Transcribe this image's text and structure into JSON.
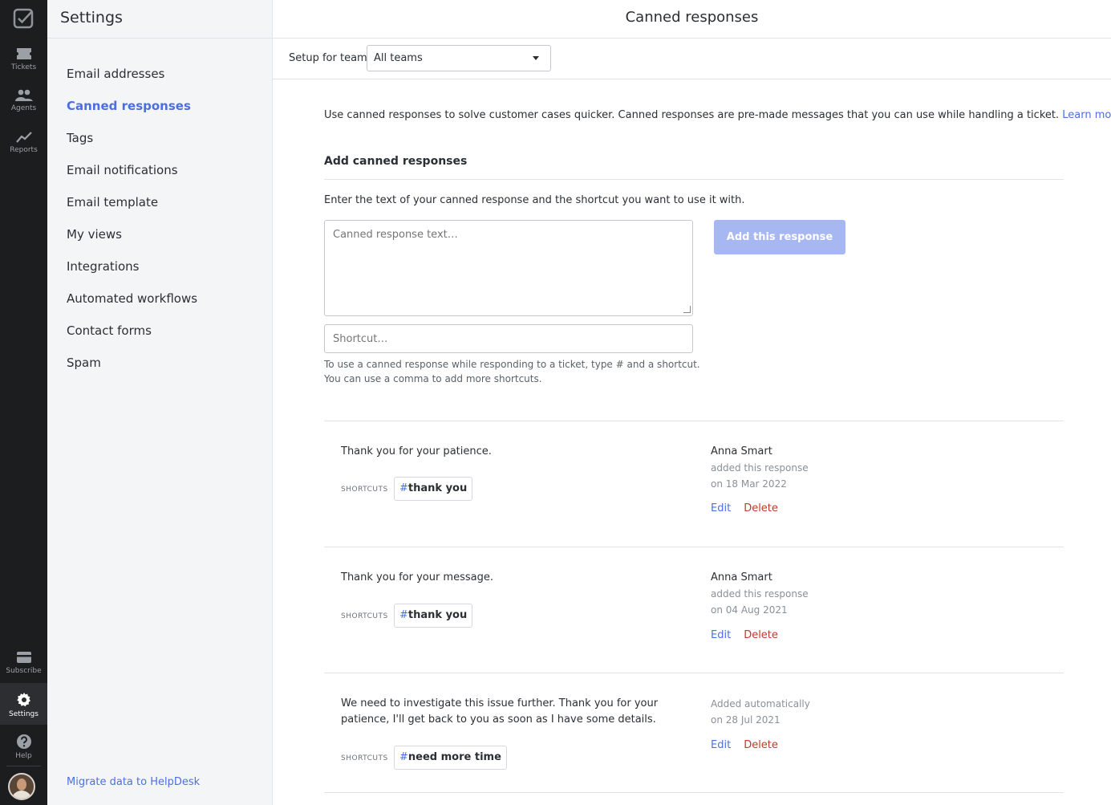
{
  "rail": {
    "items": [
      {
        "label": "Tickets"
      },
      {
        "label": "Agents"
      },
      {
        "label": "Reports"
      },
      {
        "label": "Subscribe"
      },
      {
        "label": "Settings"
      },
      {
        "label": "Help"
      }
    ]
  },
  "sidebar": {
    "title": "Settings",
    "items": [
      {
        "label": "Email addresses"
      },
      {
        "label": "Canned responses"
      },
      {
        "label": "Tags"
      },
      {
        "label": "Email notifications"
      },
      {
        "label": "Email template"
      },
      {
        "label": "My views"
      },
      {
        "label": "Integrations"
      },
      {
        "label": "Automated workflows"
      },
      {
        "label": "Contact forms"
      },
      {
        "label": "Spam"
      }
    ],
    "migrate_link": "Migrate data to HelpDesk"
  },
  "header": {
    "title": "Canned responses"
  },
  "team": {
    "label": "Setup for team",
    "selected": "All teams"
  },
  "intro": {
    "text": "Use canned responses to solve customer cases quicker. Canned responses are pre-made messages that you can use while handling a ticket.",
    "link": "Learn more"
  },
  "add": {
    "title": "Add canned responses",
    "instructions": "Enter the text of your canned response and the shortcut you want to use it with.",
    "text_placeholder": "Canned response text…",
    "shortcut_placeholder": "Shortcut…",
    "hint_line1": "To use a canned response while responding to a ticket, type # and a shortcut.",
    "hint_line2": "You can use a comma to add more shortcuts.",
    "button": "Add this response"
  },
  "responses_common": {
    "shortcuts_label": "SHORTCUTS",
    "hash": "#",
    "edit": "Edit",
    "delete": "Delete"
  },
  "responses": [
    {
      "text": "Thank you for your patience.",
      "shortcut": "thank you",
      "author": "Anna Smart",
      "added": "added this response",
      "date": "on 18 Mar 2022"
    },
    {
      "text": "Thank you for your message.",
      "shortcut": "thank you",
      "author": "Anna Smart",
      "added": "added this response",
      "date": "on 04 Aug 2021"
    },
    {
      "text": "We need to investigate this issue further. Thank you for your patience, I'll get back to you as soon as I have some details.",
      "shortcut": "need more time",
      "added": "Added automatically",
      "date": "on 28 Jul 2021"
    }
  ],
  "colors": {
    "accent": "#4c6fe0",
    "rail_bg": "#1c1d1f",
    "sidebar_bg": "#f4f5f7",
    "delete": "#c0392b",
    "button_disabled": "#a7b7f2"
  }
}
